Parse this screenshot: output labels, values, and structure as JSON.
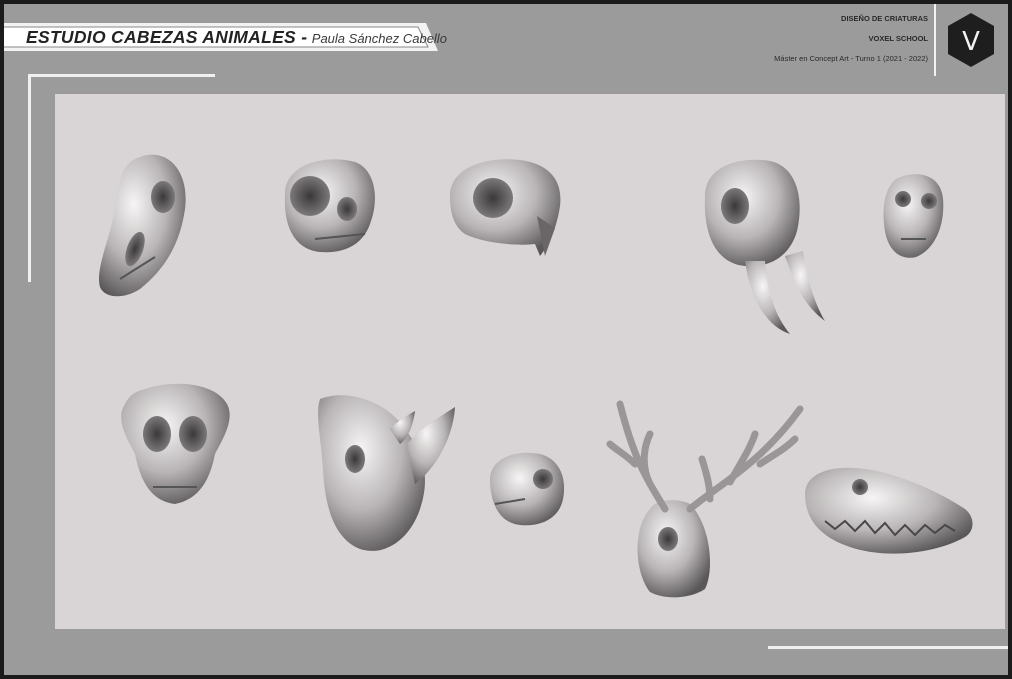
{
  "header": {
    "title": "ESTUDIO CABEZAS ANIMALES -",
    "author": "Paula Sánchez Cabello",
    "course": "DISEÑO DE CRIATURAS",
    "school": "VOXEL SCHOOL",
    "program": "Máster en Concept Art - Turno 1 (2021 - 2022)",
    "logo_letter": "V"
  },
  "colors": {
    "frame": "#9b9b9b",
    "canvas": "#d9d5d6",
    "accent_line": "#f0f0f0",
    "logo_bg": "#1e1e1e"
  },
  "skulls": [
    {
      "name": "horse-skull"
    },
    {
      "name": "cat-skull"
    },
    {
      "name": "bird-of-prey-skull"
    },
    {
      "name": "elephant-skull"
    },
    {
      "name": "small-mammal-skull"
    },
    {
      "name": "big-cat-skull"
    },
    {
      "name": "rhinoceros-skull"
    },
    {
      "name": "rodent-skull"
    },
    {
      "name": "deer-skull"
    },
    {
      "name": "crocodile-skull"
    }
  ]
}
